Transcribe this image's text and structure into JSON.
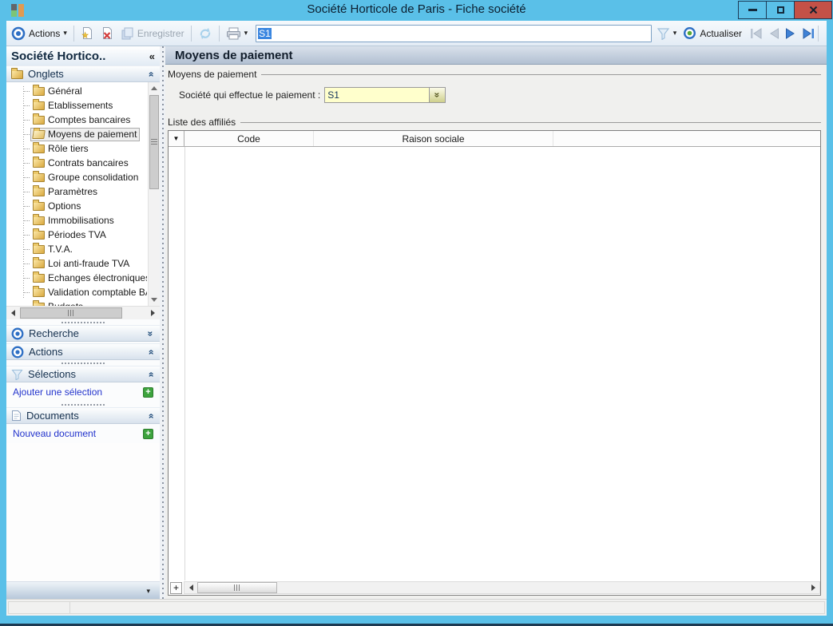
{
  "window": {
    "title": "Société Horticole de Paris -  Fiche société"
  },
  "toolbar": {
    "actions_label": "Actions",
    "save_label": "Enregistrer",
    "search_value": "S1",
    "refresh_label": "Actualiser"
  },
  "sidebar": {
    "title": "Société Hortico..",
    "onglets_label": "Onglets",
    "recherche_label": "Recherche",
    "actions_label": "Actions",
    "selections_label": "Sélections",
    "selections_link": "Ajouter une sélection",
    "documents_label": "Documents",
    "documents_link": "Nouveau document",
    "tree_items": [
      {
        "label": "Général"
      },
      {
        "label": "Etablissements"
      },
      {
        "label": "Comptes bancaires"
      },
      {
        "label": "Moyens de paiement",
        "selected": true
      },
      {
        "label": "Rôle tiers"
      },
      {
        "label": "Contrats bancaires"
      },
      {
        "label": "Groupe consolidation"
      },
      {
        "label": "Paramètres"
      },
      {
        "label": "Options"
      },
      {
        "label": "Immobilisations"
      },
      {
        "label": "Périodes TVA"
      },
      {
        "label": "T.V.A."
      },
      {
        "label": "Loi anti-fraude TVA"
      },
      {
        "label": "Echanges électroniques"
      },
      {
        "label": "Validation comptable BA"
      },
      {
        "label": "Budgets"
      }
    ]
  },
  "main": {
    "header": "Moyens de paiement",
    "payment_group": {
      "label": "Moyens de paiement",
      "field_label": "Société qui effectue le paiement :",
      "field_value": "S1"
    },
    "affiliates_group": {
      "label": "Liste des affiliés",
      "columns": [
        "Code",
        "Raison sociale"
      ],
      "rows": []
    },
    "add_row_glyph": "+"
  },
  "icons": {
    "collapse_left": "«",
    "chevron_double": "»",
    "dropdown_caret": "▾",
    "row_marker": "▼"
  },
  "colors": {
    "titlebar": "#5ac0e8",
    "close_button": "#c45147",
    "combo_background": "#ffffcc",
    "link": "#2233cc",
    "add_button_green": "#3da33d",
    "text_selection": "#3a86e0"
  }
}
